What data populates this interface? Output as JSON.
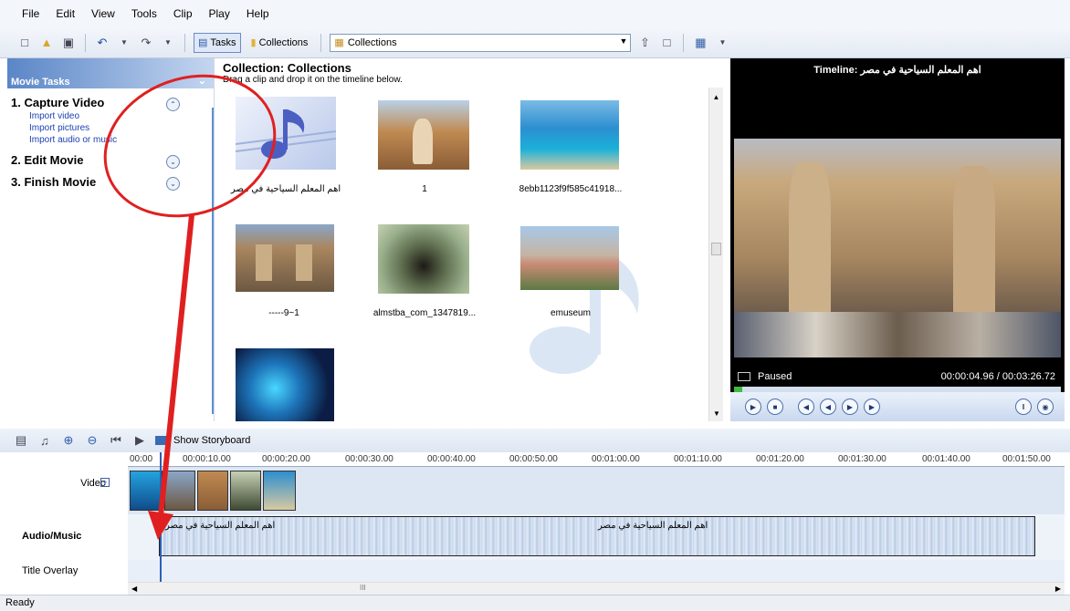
{
  "menu": {
    "items": [
      "File",
      "Edit",
      "View",
      "Tools",
      "Clip",
      "Play",
      "Help"
    ]
  },
  "toolbar": {
    "tasks_label": "Tasks",
    "collections_label": "Collections",
    "combo_value": "Collections"
  },
  "tasks": {
    "header": "Movie Tasks",
    "sections": [
      {
        "title": "1. Capture Video",
        "links": [
          "Import video",
          "Import pictures",
          "Import audio or music"
        ]
      },
      {
        "title": "2. Edit Movie"
      },
      {
        "title": "3. Finish Movie"
      }
    ]
  },
  "collection": {
    "title": "Collection: Collections",
    "subtitle": "Drag a clip and drop it on the timeline below.",
    "items": [
      "اهم المعلم السياحية في مصر",
      "1",
      "8ebb1123f9f585c41918...",
      "-----9~1",
      "almstba_com_1347819...",
      "emuseum",
      ""
    ]
  },
  "preview": {
    "title": "Timeline: اهم المعلم السياحية في مصر",
    "status": "Paused",
    "time": "00:00:04.96 / 00:03:26.72"
  },
  "timeline": {
    "storyboard_label": "Show Storyboard",
    "ruler": [
      "00:00",
      "00:00:10.00",
      "00:00:20.00",
      "00:00:30.00",
      "00:00:40.00",
      "00:00:50.00",
      "00:01:00.00",
      "00:01:10.00",
      "00:01:20.00",
      "00:01:30.00",
      "00:01:40.00",
      "00:01:50.00"
    ],
    "tracks": {
      "video": "Video",
      "audio": "Audio/Music",
      "title": "Title Overlay"
    },
    "audio_clip_label": "اهم المعلم السياحية في مصر",
    "audio_clip_label_2": "اهم المعلم السياحية في مصر"
  },
  "scrollbar": {
    "center": "III"
  },
  "status": {
    "text": "Ready"
  }
}
